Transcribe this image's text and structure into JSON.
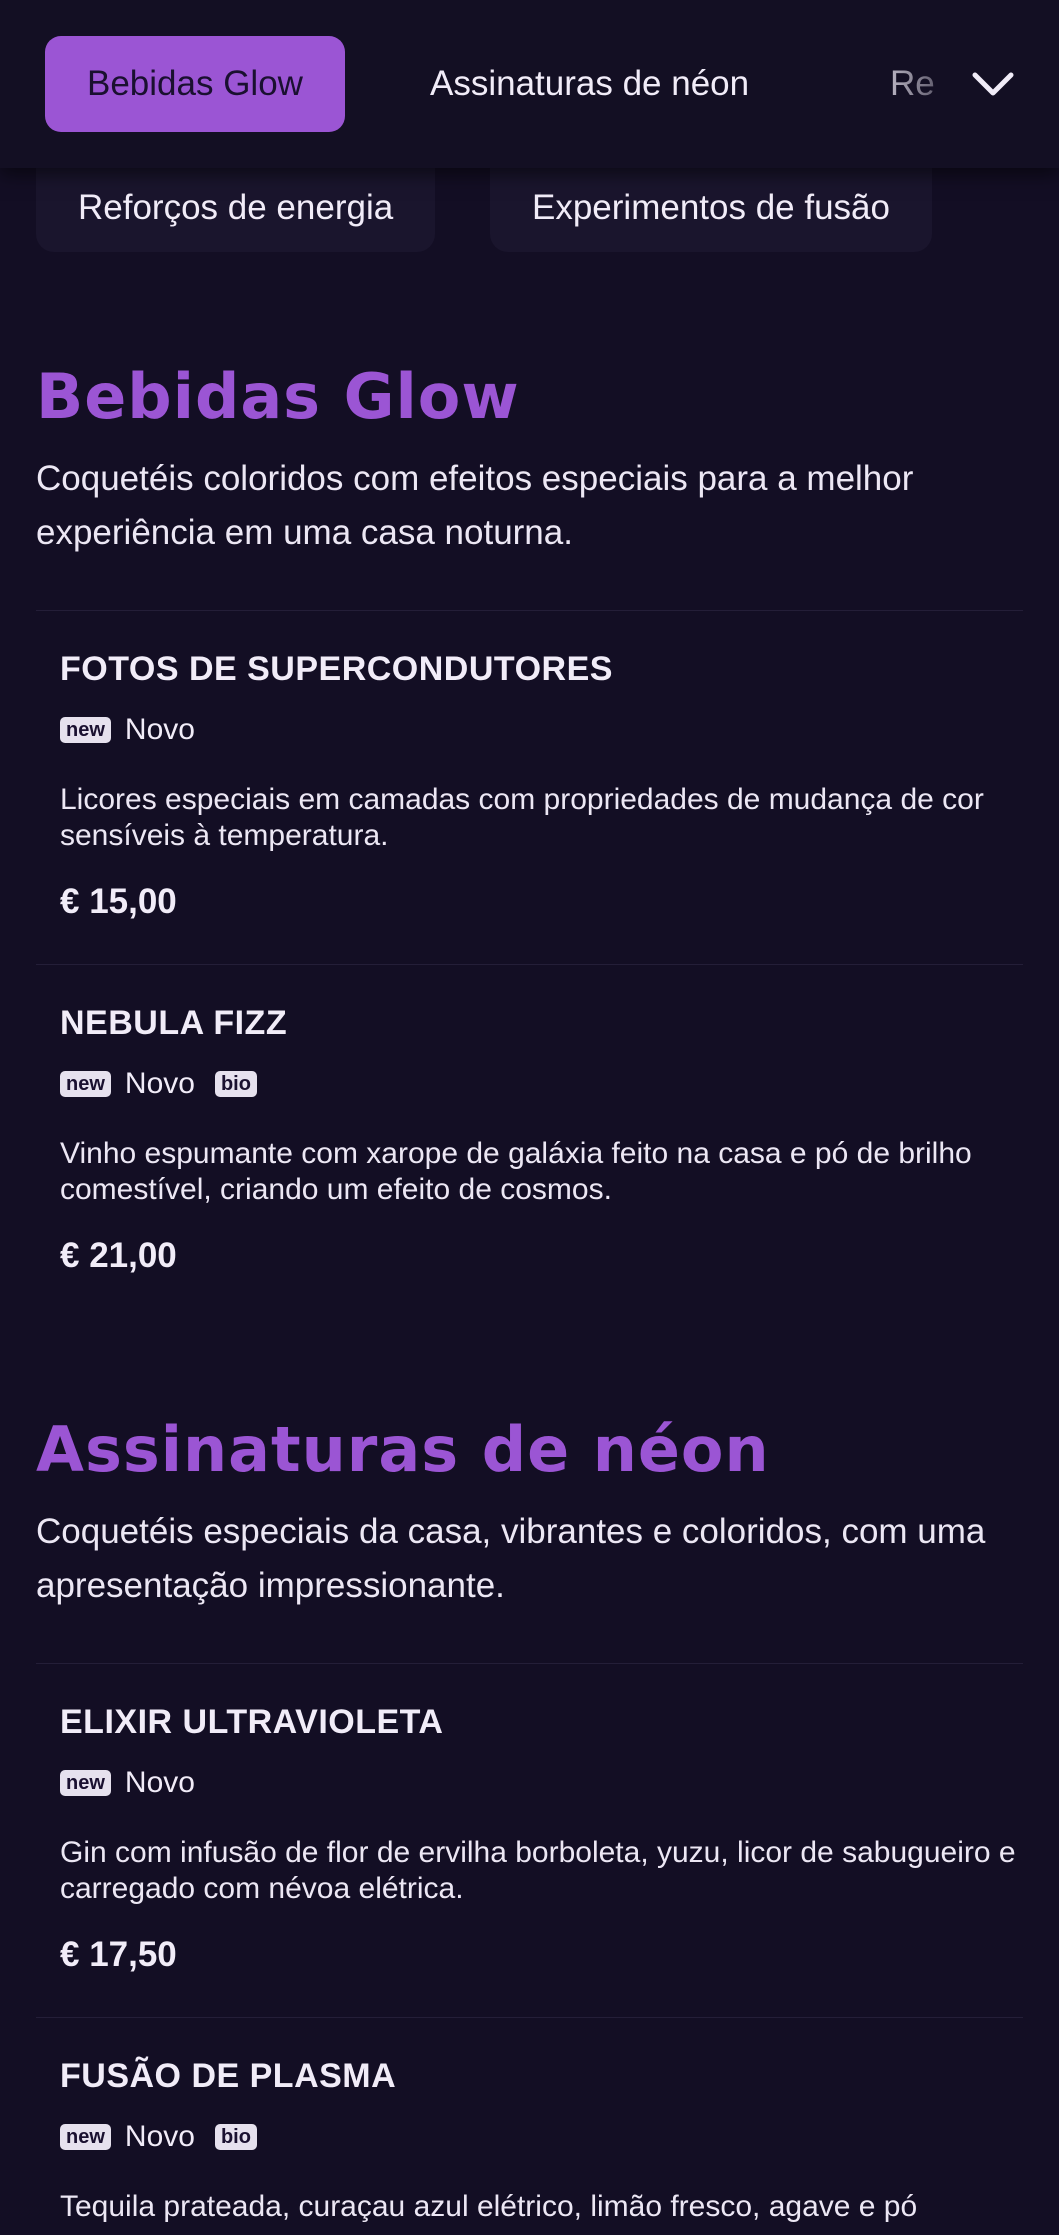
{
  "tabs": [
    {
      "label": "Bebidas Glow",
      "active": true
    },
    {
      "label": "Assinaturas de néon",
      "active": false
    },
    {
      "label": "Re",
      "active": false
    }
  ],
  "chips": [
    {
      "label": "Reforços de energia"
    },
    {
      "label": "Experimentos de fusão"
    }
  ],
  "icons": {
    "expand": "chevron-down-icon"
  },
  "colors": {
    "background": "#130e24",
    "accent": "#9b55d4"
  },
  "sections": [
    {
      "title": "Bebidas Glow",
      "description": "Coquetéis coloridos com efeitos especiais para a melhor experiência em uma casa noturna.",
      "items": [
        {
          "name": "FOTOS DE SUPERCONDUTORES",
          "badges": [
            {
              "badge": "new",
              "label": "Novo"
            }
          ],
          "description": "Licores especiais em camadas com propriedades de mudança de cor sensíveis à temperatura.",
          "price": "€ 15,00"
        },
        {
          "name": "NEBULA FIZZ",
          "badges": [
            {
              "badge": "new",
              "label": "Novo"
            },
            {
              "badge": "bio",
              "label": ""
            }
          ],
          "description": "Vinho espumante com xarope de galáxia feito na casa e pó de brilho comestível, criando um efeito de cosmos.",
          "price": "€ 21,00"
        }
      ]
    },
    {
      "title": "Assinaturas de néon",
      "description": "Coquetéis especiais da casa, vibrantes e coloridos, com uma apresentação impressionante.",
      "items": [
        {
          "name": "ELIXIR ULTRAVIOLETA",
          "badges": [
            {
              "badge": "new",
              "label": "Novo"
            }
          ],
          "description": "Gin com infusão de flor de ervilha borboleta, yuzu, licor de sabugueiro e carregado com névoa elétrica.",
          "price": "€ 17,50"
        },
        {
          "name": "FUSÃO DE PLASMA",
          "badges": [
            {
              "badge": "new",
              "label": "Novo"
            },
            {
              "badge": "bio",
              "label": ""
            }
          ],
          "description": "Tequila prateada, curaçau azul elétrico, limão fresco, agave e pó",
          "price": ""
        }
      ]
    }
  ]
}
